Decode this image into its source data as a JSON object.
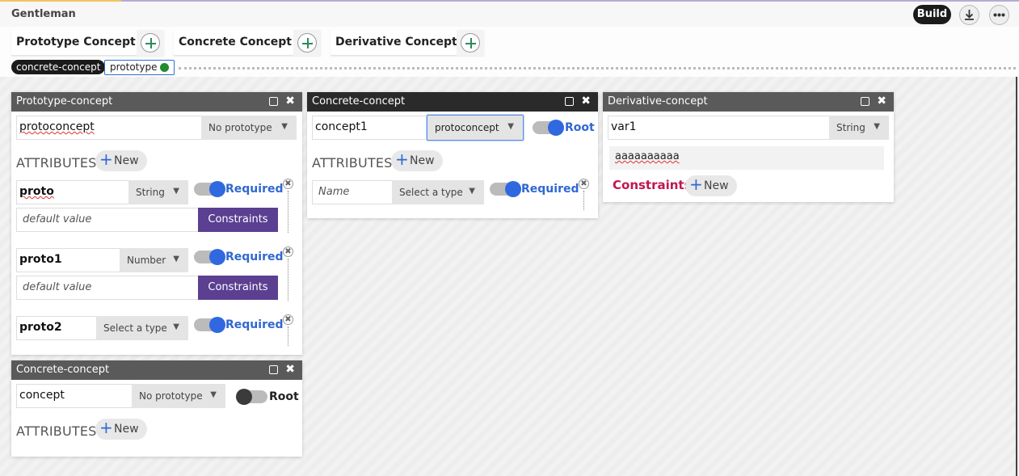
{
  "app": {
    "title": "Gentleman"
  },
  "topbar": {
    "build_label": "Build",
    "download_icon": "download-icon",
    "more_icon": "more-icon",
    "more_glyph": "•••",
    "download_glyph": "⤓"
  },
  "toolbar": {
    "tabs": [
      {
        "label": "Prototype Concept"
      },
      {
        "label": "Concrete Concept"
      },
      {
        "label": "Derivative Concept"
      }
    ]
  },
  "tags": [
    {
      "label": "concrete-concept"
    },
    {
      "label": "prototype"
    }
  ],
  "colors": {
    "accent_blue": "#2f68d2",
    "constraints_purple": "#5b3f91",
    "constraints_red": "#c01650",
    "status_green": "#1f8c2f"
  },
  "panels": {
    "prototype": {
      "title": "Prototype-concept",
      "name": "protoconcept",
      "prototype_select": "No prototype",
      "attributes_label": "ATTRIBUTES",
      "new_label": "New",
      "attributes": [
        {
          "name": "proto",
          "type": "String",
          "required_label": "Required",
          "required": true,
          "default_placeholder": "default value",
          "constraints_label": "Constraints"
        },
        {
          "name": "proto1",
          "type": "Number",
          "required_label": "Required",
          "required": true,
          "default_placeholder": "default value",
          "constraints_label": "Constraints"
        },
        {
          "name": "proto2",
          "type": "Select a type",
          "required_label": "Required",
          "required": true
        }
      ]
    },
    "concrete_main": {
      "title": "Concrete-concept",
      "name": "concept1",
      "prototype_select": "protoconcept",
      "root_label": "Root",
      "root": true,
      "attributes_label": "ATTRIBUTES",
      "new_label": "New",
      "attributes": [
        {
          "name_placeholder": "Name",
          "type": "Select a type",
          "required_label": "Required",
          "required": true
        }
      ]
    },
    "derivative": {
      "title": "Derivative-concept",
      "name": "var1",
      "type": "String",
      "value": "aaaaaaaaaa",
      "constraints_label": "Constraints",
      "new_label": "New"
    },
    "concrete_second": {
      "title": "Concrete-concept",
      "name": "concept",
      "prototype_select": "No prototype",
      "root_label": "Root",
      "root": false,
      "attributes_label": "ATTRIBUTES",
      "new_label": "New"
    }
  },
  "glyphs": {
    "close": "✖",
    "caret": "▼",
    "plus": "+",
    "remove": "✖"
  }
}
